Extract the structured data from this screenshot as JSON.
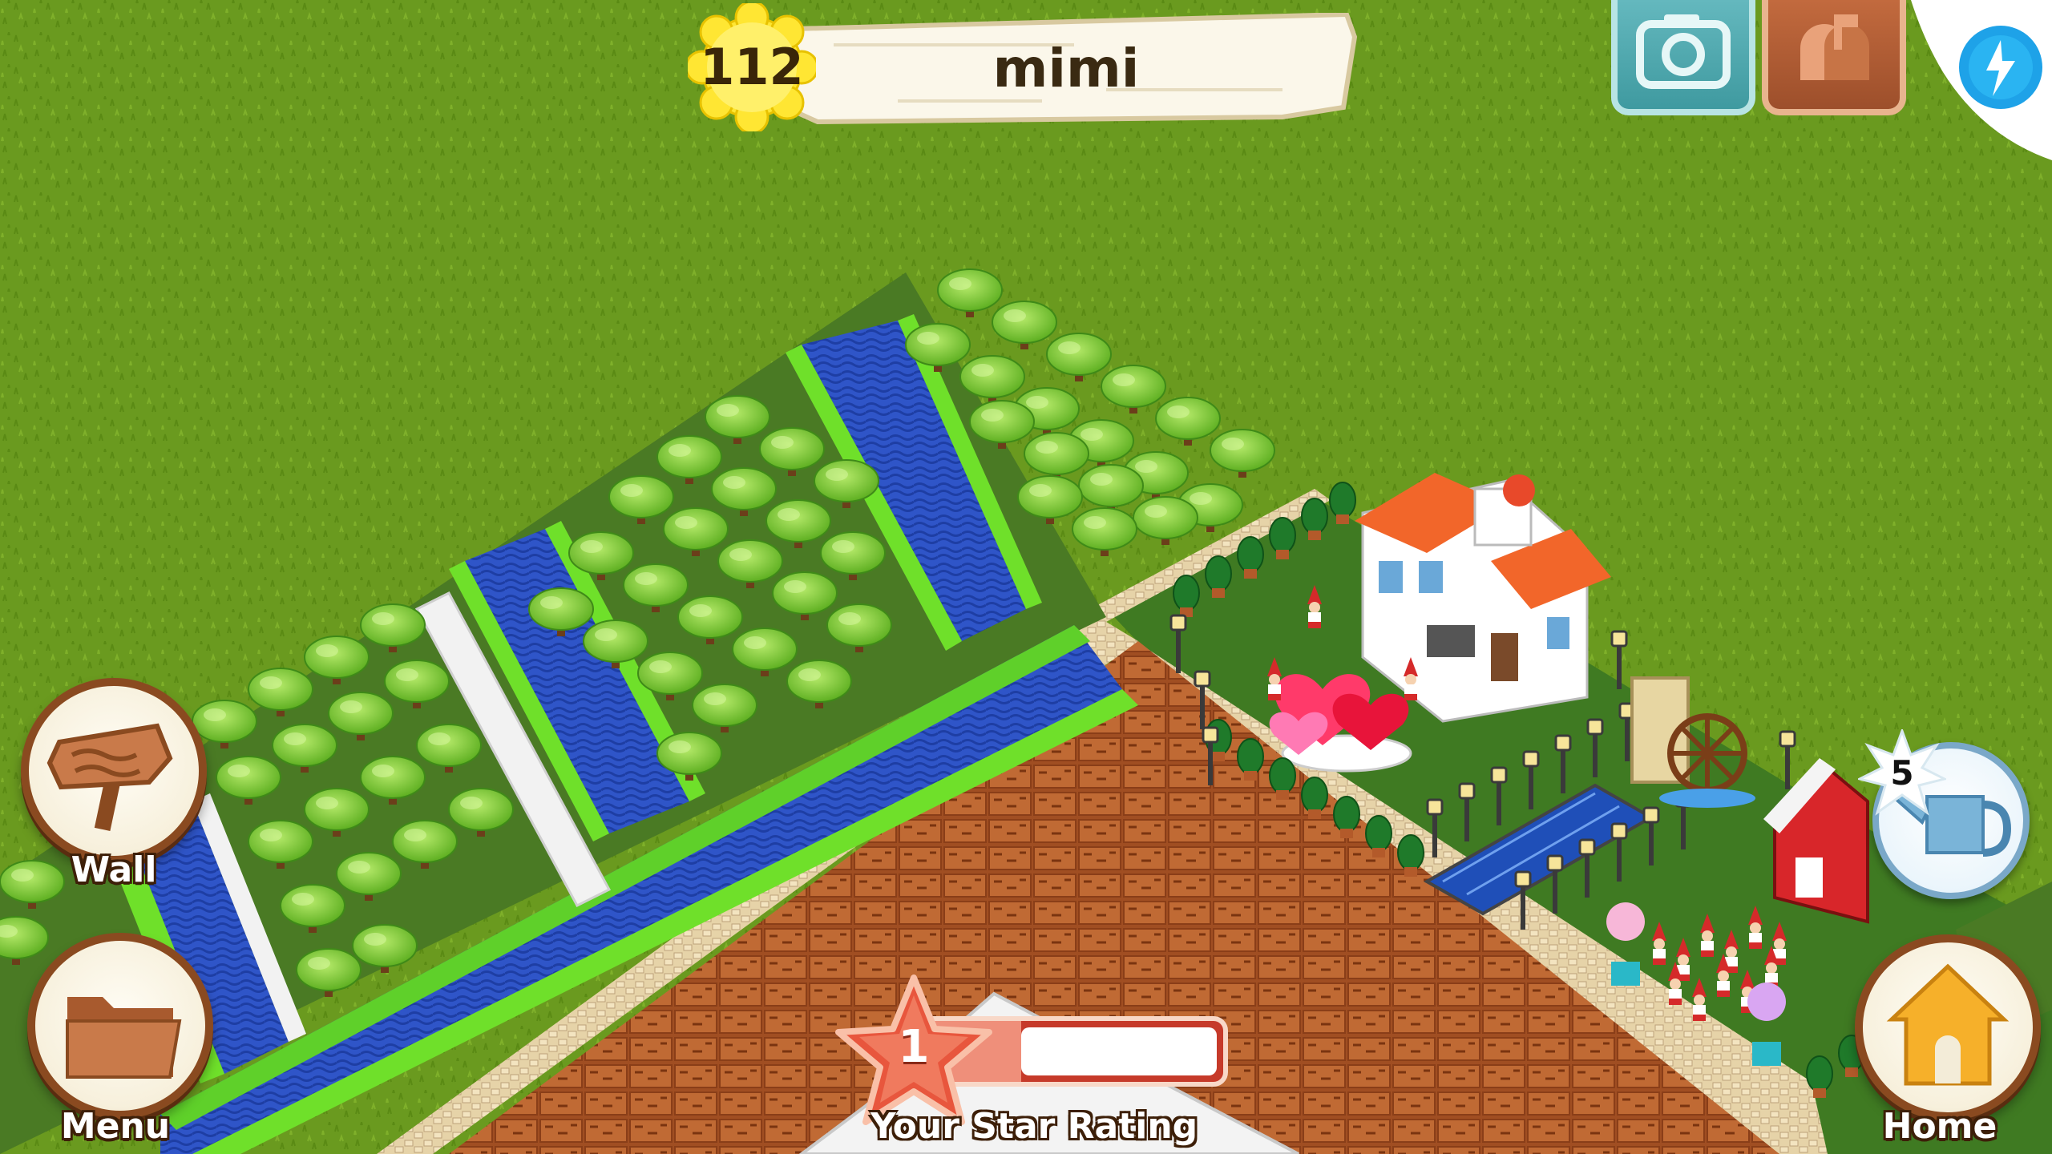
{
  "player": {
    "level": "112",
    "name": "mimi"
  },
  "toolbar": {
    "camera_icon": "camera-icon",
    "mail_icon": "mailbox-icon",
    "corner_icon": "bluestacks-icon"
  },
  "buttons": {
    "wall_label": "Wall",
    "menu_label": "Menu",
    "home_label": "Home"
  },
  "watering": {
    "count": "5",
    "icon": "watering-can-icon"
  },
  "star_rating": {
    "value": "1",
    "progress": 0.15,
    "label": "Your Star Rating"
  },
  "colors": {
    "grass": "#6a9a1f",
    "plank": "#fbf7ea",
    "star_red": "#e8563d",
    "button_brown": "#8a4a20",
    "water_blue": "#2f55c8",
    "hedge_green": "#6fe02a"
  }
}
